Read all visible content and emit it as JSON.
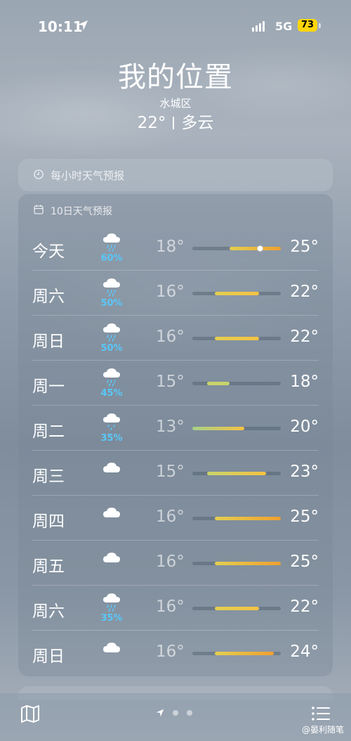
{
  "status": {
    "time": "10:11",
    "network": "5G",
    "battery": "73"
  },
  "header": {
    "city": "我的位置",
    "district": "水城区",
    "temp": "22°",
    "condition": "多云"
  },
  "hourly": {
    "label": "每小时天气预报",
    "icon": "clock-icon"
  },
  "daily": {
    "label": "10日天气预报",
    "icon": "calendar-icon",
    "range_min": 13,
    "range_max": 25,
    "days": [
      {
        "day": "今天",
        "icon": "rain-cloud",
        "precip": "60%",
        "low": "18°",
        "high": "25°",
        "low_val": 18,
        "high_val": 25,
        "current_val": 22
      },
      {
        "day": "周六",
        "icon": "rain-cloud",
        "precip": "50%",
        "low": "16°",
        "high": "22°",
        "low_val": 16,
        "high_val": 22
      },
      {
        "day": "周日",
        "icon": "rain-cloud",
        "precip": "50%",
        "low": "16°",
        "high": "22°",
        "low_val": 16,
        "high_val": 22
      },
      {
        "day": "周一",
        "icon": "rain-cloud",
        "precip": "45%",
        "low": "15°",
        "high": "18°",
        "low_val": 15,
        "high_val": 18
      },
      {
        "day": "周二",
        "icon": "drizzle-cloud",
        "precip": "35%",
        "low": "13°",
        "high": "20°",
        "low_val": 13,
        "high_val": 20
      },
      {
        "day": "周三",
        "icon": "cloud",
        "precip": "",
        "low": "15°",
        "high": "23°",
        "low_val": 15,
        "high_val": 23
      },
      {
        "day": "周四",
        "icon": "cloud",
        "precip": "",
        "low": "16°",
        "high": "25°",
        "low_val": 16,
        "high_val": 25
      },
      {
        "day": "周五",
        "icon": "cloud",
        "precip": "",
        "low": "16°",
        "high": "25°",
        "low_val": 16,
        "high_val": 25
      },
      {
        "day": "周六",
        "icon": "rain-cloud",
        "precip": "35%",
        "low": "16°",
        "high": "22°",
        "low_val": 16,
        "high_val": 22
      },
      {
        "day": "周日",
        "icon": "cloud",
        "precip": "",
        "low": "16°",
        "high": "24°",
        "low_val": 16,
        "high_val": 24
      }
    ]
  },
  "bottom": {
    "map_icon": "map-icon",
    "list_icon": "list-icon",
    "watermark": "@晏利随笔"
  },
  "colors": {
    "precip": "#5ac8fa",
    "cool": "#a6d18a",
    "warm": "#f5c242",
    "hot": "#f0a030"
  }
}
